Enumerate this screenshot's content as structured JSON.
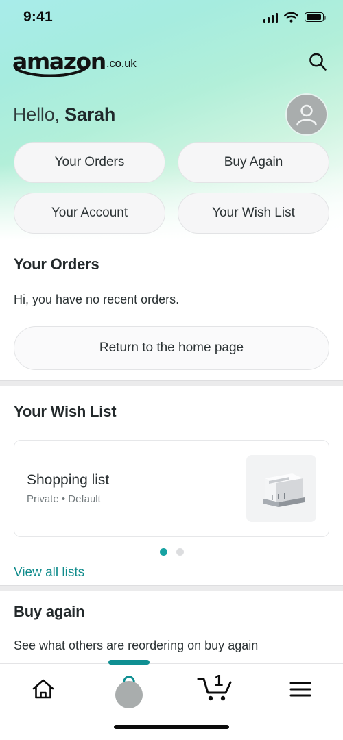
{
  "status_bar": {
    "time": "9:41",
    "cellular_icon": "signal-bars-icon",
    "wifi_icon": "wifi-icon",
    "battery_icon": "battery-icon"
  },
  "header": {
    "logo_word": "amazon",
    "logo_tld": ".co.uk",
    "search_icon": "search-icon",
    "greeting_prefix": "Hello, ",
    "greeting_name": "Sarah",
    "avatar_icon": "person-avatar-icon"
  },
  "quick_links": [
    {
      "label": "Your Orders"
    },
    {
      "label": "Buy Again"
    },
    {
      "label": "Your Account"
    },
    {
      "label": "Your Wish List"
    }
  ],
  "orders_section": {
    "title": "Your Orders",
    "empty_message": "Hi, you have no recent orders.",
    "button_label": "Return to the home page"
  },
  "wishlist_section": {
    "title": "Your Wish List",
    "card": {
      "name": "Shopping list",
      "meta": "Private • Default",
      "thumbnail_icon": "storage-caddy-product-image"
    },
    "carousel": {
      "total_dots": 2,
      "active_index": 0
    },
    "view_all_label": "View all lists"
  },
  "buyagain_section": {
    "title": "Buy again",
    "subtitle": "See what others are reordering on buy again"
  },
  "tab_bar": {
    "tabs": [
      {
        "name": "home",
        "icon": "home-icon",
        "active": false
      },
      {
        "name": "account",
        "icon": "person-icon",
        "active": true
      },
      {
        "name": "cart",
        "icon": "shopping-cart-icon",
        "badge": "1",
        "active": false
      },
      {
        "name": "menu",
        "icon": "hamburger-menu-icon",
        "active": false
      }
    ]
  },
  "colors": {
    "accent_teal": "#0f8f92",
    "link_teal": "#118c8c",
    "gradient_top": "#a8ecea",
    "gradient_bottom": "#ffffff",
    "text_primary": "#23292b",
    "text_muted": "#71797c"
  }
}
